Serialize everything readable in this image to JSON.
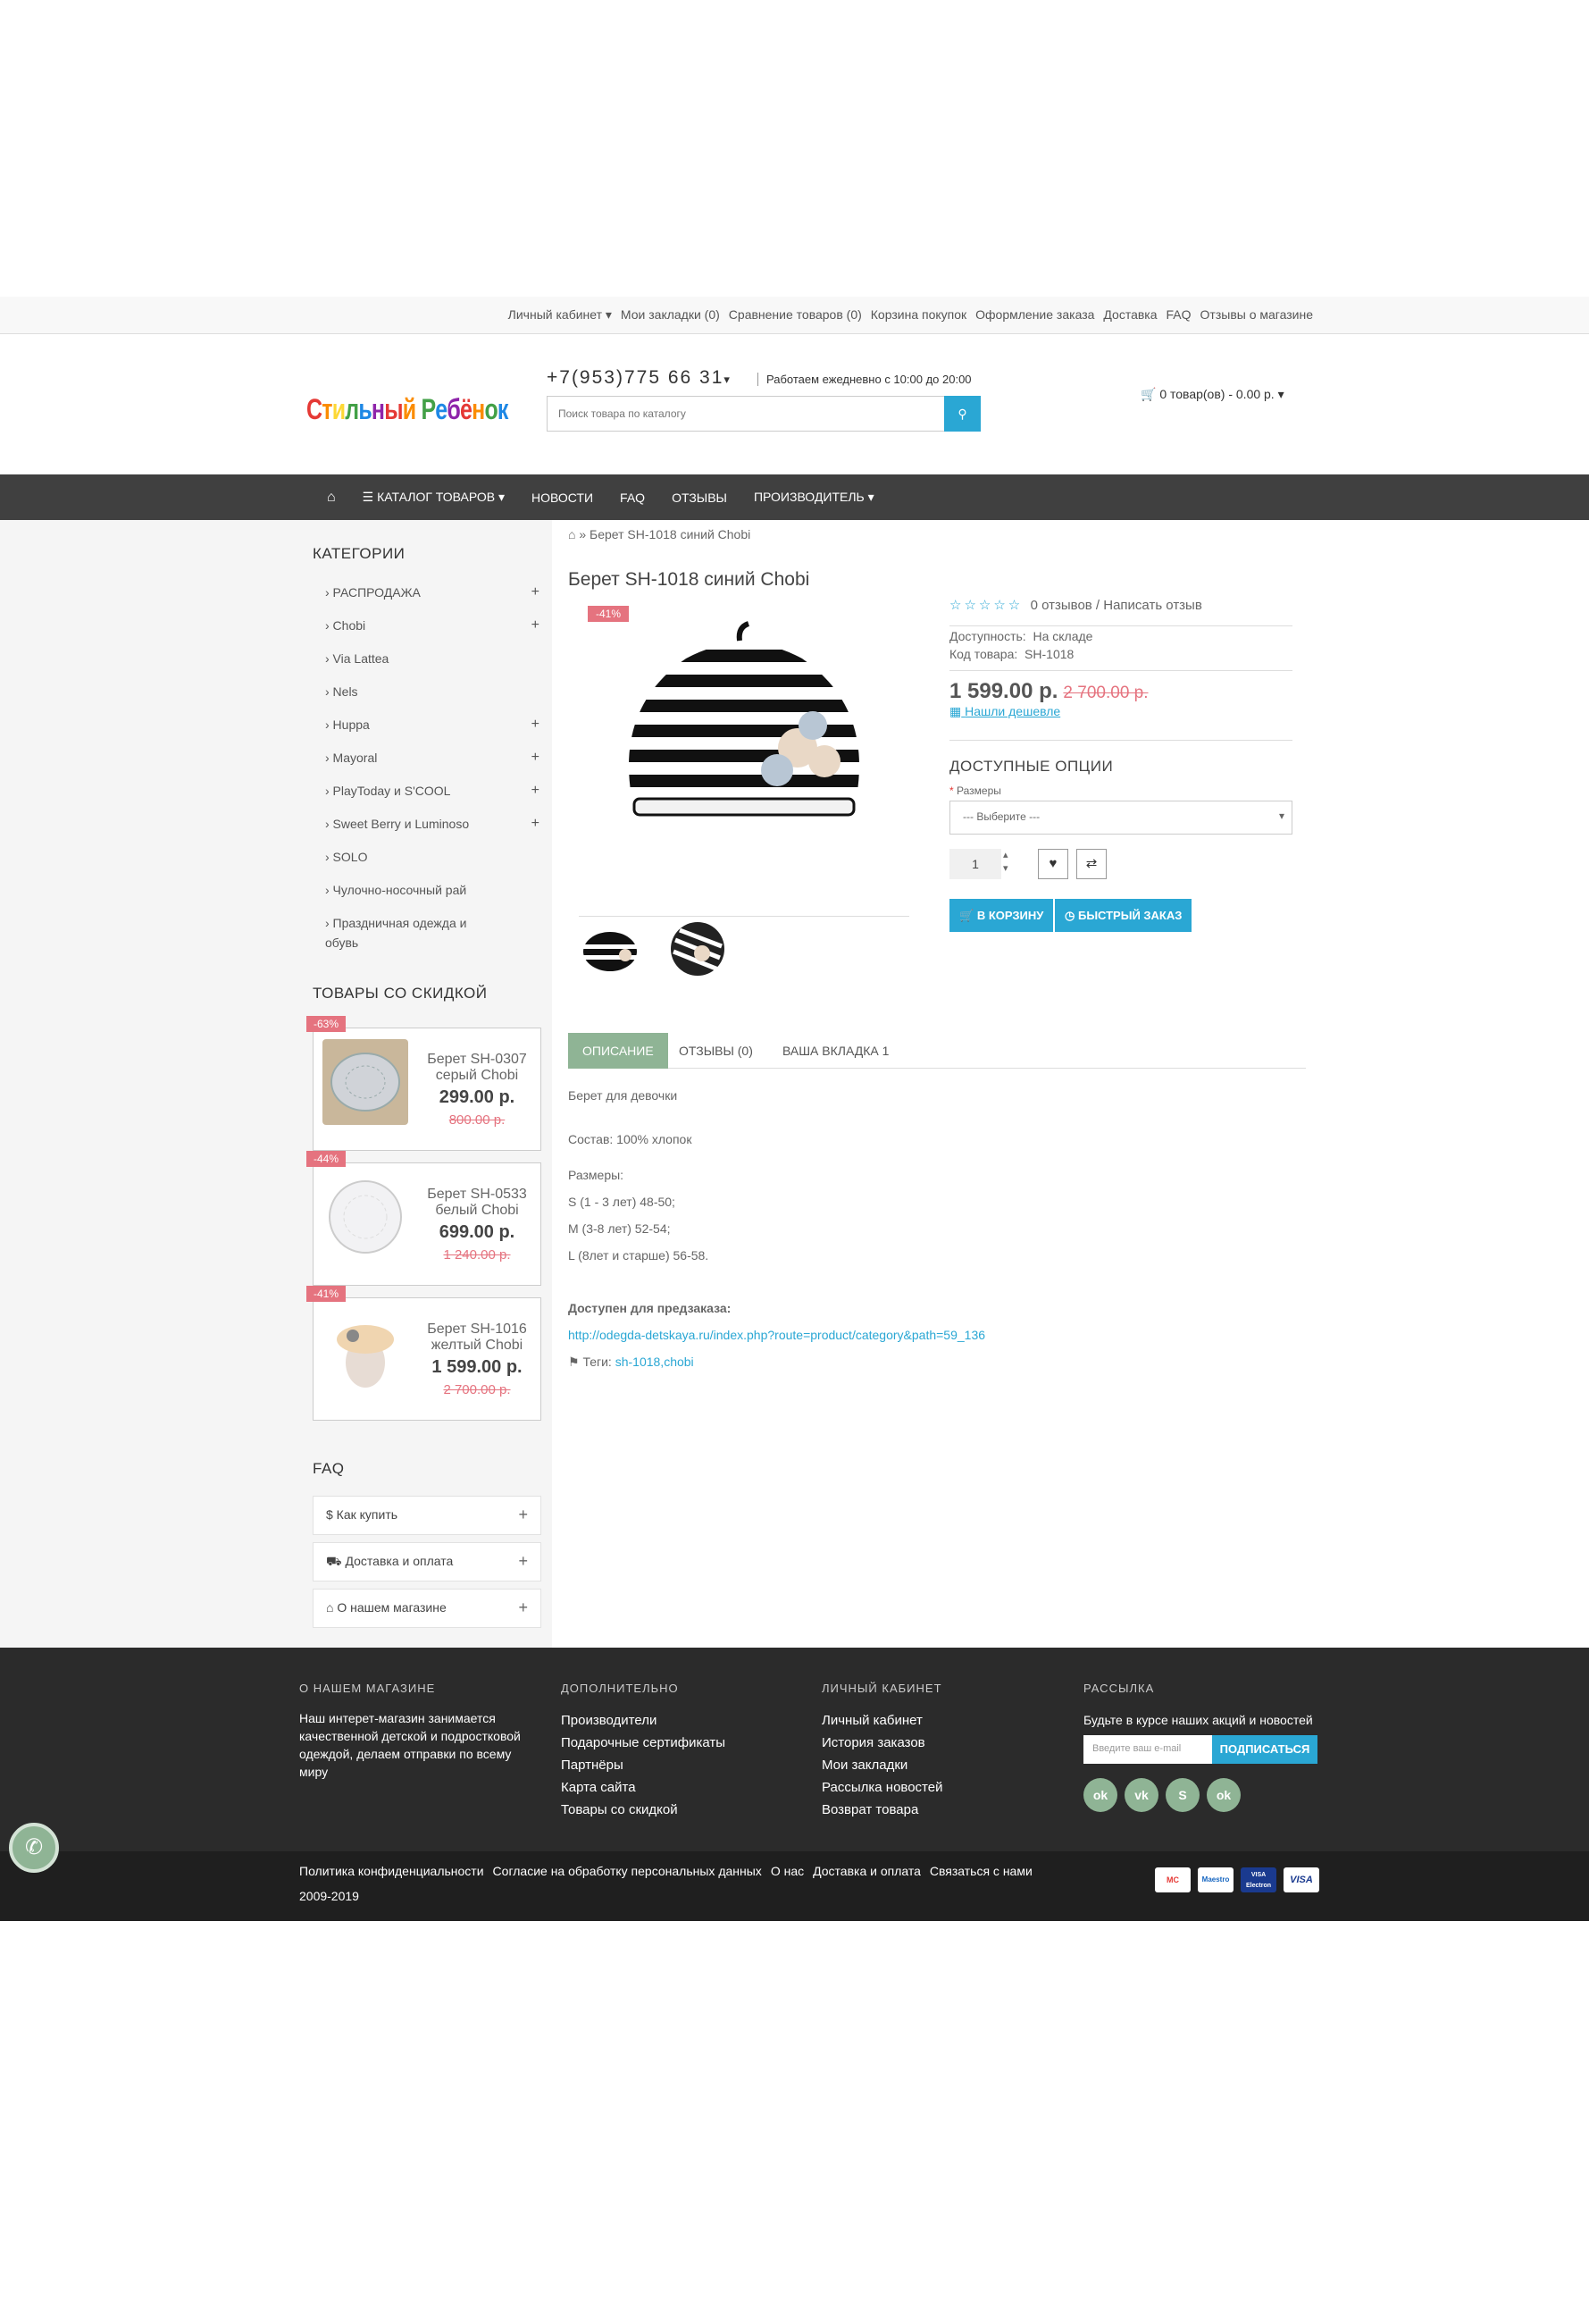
{
  "top_links": [
    "Личный кабинет ▾",
    "Мои закладки (0)",
    "Сравнение товаров (0)",
    "Корзина покупок",
    "Оформление заказа",
    "Доставка",
    "FAQ",
    "Отзывы о магазине"
  ],
  "header": {
    "logo": "Стильный Ребёнок",
    "phone": "+7(953)775 66 31",
    "hours": "Работаем ежедневно с 10:00 до 20:00",
    "search_placeholder": "Поиск товара по каталогу",
    "cart": "0 товар(ов) - 0.00 р."
  },
  "nav": [
    "КАТАЛОГ ТОВАРОВ",
    "НОВОСТИ",
    "FAQ",
    "ОТЗЫВЫ",
    "ПРОИЗВОДИТЕЛЬ"
  ],
  "sidebar": {
    "categories_title": "КАТЕГОРИИ",
    "categories": [
      {
        "label": "› РАСПРОДАЖА",
        "expand": true
      },
      {
        "label": "› Chobi",
        "expand": true
      },
      {
        "label": "› Via Lattea",
        "expand": false
      },
      {
        "label": "› Nels",
        "expand": false
      },
      {
        "label": "› Huppa",
        "expand": true
      },
      {
        "label": "› Mayoral",
        "expand": true
      },
      {
        "label": "› PlayToday и S'COOL",
        "expand": true
      },
      {
        "label": "› Sweet Berry и Luminoso",
        "expand": true
      },
      {
        "label": "› SOLO",
        "expand": false
      },
      {
        "label": "› Чулочно-носочный рай",
        "expand": false
      },
      {
        "label": "› Праздничная одежда и обувь",
        "expand": false
      }
    ],
    "deals_title": "ТОВАРЫ СО СКИДКОЙ",
    "deals": [
      {
        "badge": "-63%",
        "name": "Берет SH-0307 серый Chobi",
        "price": "299.00 р.",
        "old": "800.00 р."
      },
      {
        "badge": "-44%",
        "name": "Берет SH-0533 белый Chobi",
        "price": "699.00 р.",
        "old": "1 240.00 р."
      },
      {
        "badge": "-41%",
        "name": "Берет SH-1016 желтый Chobi",
        "price": "1 599.00 р.",
        "old": "2 700.00 р."
      }
    ],
    "faq_title": "FAQ",
    "faq": [
      "$ Как купить",
      "⛟ Доставка и оплата",
      "⌂ О нашем магазине"
    ]
  },
  "product": {
    "breadcrumb": "Берет SH-1018 синий Chobi",
    "title": "Берет SH-1018 синий Chobi",
    "badge": "-41%",
    "reviews": "0 отзывов / Написать отзыв",
    "availability_label": "Доступность:",
    "availability": "На складе",
    "code_label": "Код товара:",
    "code": "SH-1018",
    "price": "1 599.00 р.",
    "old_price": "2 700.00 р.",
    "cheaper": "Нашли дешевле",
    "options_title": "ДОСТУПНЫЕ ОПЦИИ",
    "size_label": "Размеры",
    "size_value": "--- Выберите ---",
    "qty": "1",
    "cart_btn": "В КОРЗИНУ",
    "quick_btn": "БЫСТРЫЙ ЗАКАЗ",
    "rating": 0
  },
  "tabs": [
    "ОПИСАНИЕ",
    "ОТЗЫВЫ (0)",
    "ВАША ВКЛАДКА 1"
  ],
  "description": {
    "line1": "Берет для девочки",
    "line2": "Состав: 100% хлопок",
    "sizes_title": "Размеры:",
    "sizes": [
      "S (1 - 3 лет) 48-50;",
      "M (3-8 лет) 52-54;",
      "L  (8лет и старше) 56-58."
    ],
    "preorder": "Доступен для предзаказа:",
    "link": "http://odegda-detskaya.ru/index.php?route=product/category&path=59_136",
    "tags_label": "Теги:",
    "tags": "sh-1018,chobi"
  },
  "footer": {
    "about_title": "О НАШЕМ МАГАЗИНЕ",
    "about_text": "Наш интерет-магазин занимается качественной детской и подростковой одеждой, делаем отправки по всему миру",
    "extra_title": "ДОПОЛНИТЕЛЬНО",
    "extra": [
      "Производители",
      "Подарочные сертификаты",
      "Партнёры",
      "Карта сайта",
      "Товары со скидкой"
    ],
    "account_title": "ЛИЧНЫЙ КАБИНЕТ",
    "account": [
      "Личный кабинет",
      "История заказов",
      "Мои закладки",
      "Рассылка новостей",
      "Возврат товара"
    ],
    "news_title": "РАССЫЛКА",
    "news_text": "Будьте в курсе наших акций и новостей",
    "email_placeholder": "Введите ваш e-mail",
    "subscribe": "ПОДПИСАТЬСЯ",
    "social": [
      "ok",
      "vk",
      "S",
      "ok"
    ],
    "bottom_links": [
      "Политика конфиденциальности",
      "Согласие на обработку персональных данных",
      "О нас",
      "Доставка и оплата",
      "Связаться с нами"
    ],
    "copyright": "2009-2019",
    "cards": [
      "MC",
      "Maestro",
      "VISA Electron",
      "VISA"
    ]
  },
  "colors": {
    "accent": "#2aa7d4",
    "nav": "#404040",
    "badge": "#e5737f",
    "green": "#8fb495"
  }
}
